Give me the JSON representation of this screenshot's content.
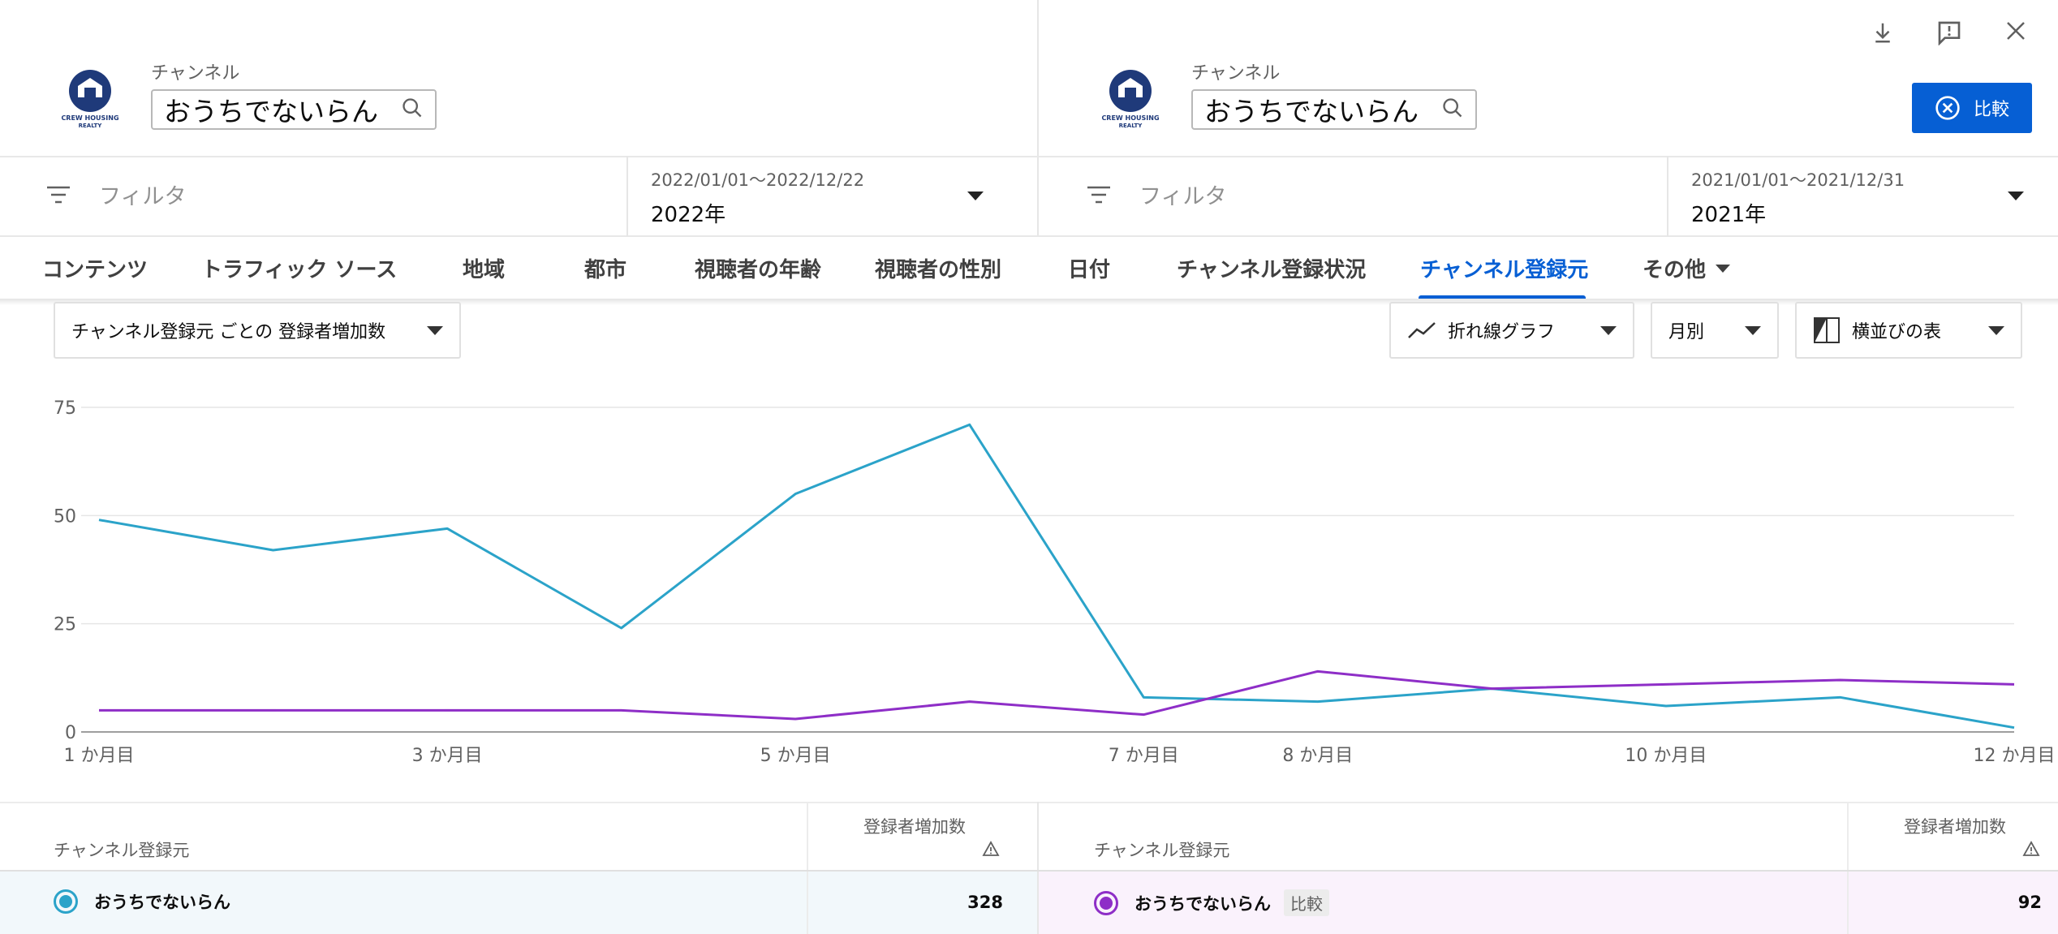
{
  "left_panel": {
    "logo_text": "CREW HOUSING REALTY",
    "channel_label": "チャンネル",
    "channel_name": "おうちでないらん",
    "filter_placeholder": "フィルタ",
    "date_range": "2022/01/01～2022/12/22",
    "date_label": "2022年"
  },
  "right_panel": {
    "logo_text": "CREW HOUSING REALTY",
    "channel_label": "チャンネル",
    "channel_name": "おうちでないらん",
    "filter_placeholder": "フィルタ",
    "date_range": "2021/01/01～2021/12/31",
    "date_label": "2021年",
    "compare_button": "比較"
  },
  "top_icons": [
    "download-icon",
    "feedback-icon",
    "close-icon"
  ],
  "tabs": [
    {
      "label": "コンテンツ"
    },
    {
      "label": "トラフィック ソース"
    },
    {
      "label": "地域"
    },
    {
      "label": "都市"
    },
    {
      "label": "視聴者の年齢"
    },
    {
      "label": "視聴者の性別"
    },
    {
      "label": "日付"
    },
    {
      "label": "チャンネル登録状況"
    },
    {
      "label": "チャンネル登録元",
      "active": true
    },
    {
      "label": "その他"
    }
  ],
  "controls": {
    "metric_select": "チャンネル登録元 ごとの 登録者増加数",
    "chart_type": "折れ線グラフ",
    "interval": "月別",
    "table_view": "横並びの表"
  },
  "chart_data": {
    "type": "line",
    "x": [
      1,
      2,
      3,
      4,
      5,
      6,
      7,
      8,
      9,
      10,
      11,
      12
    ],
    "x_tick_labels": [
      {
        "x": 1,
        "label": "1 か月目"
      },
      {
        "x": 3,
        "label": "3 か月目"
      },
      {
        "x": 5,
        "label": "5 か月目"
      },
      {
        "x": 7,
        "label": "7 か月目"
      },
      {
        "x": 8,
        "label": "8 か月目"
      },
      {
        "x": 10,
        "label": "10 か月目"
      },
      {
        "x": 12,
        "label": "12 か月目"
      }
    ],
    "y_ticks": [
      0,
      25,
      50,
      75
    ],
    "ylim": [
      0,
      75
    ],
    "grid": true,
    "series": [
      {
        "color": "#2ba3c9",
        "values": [
          49,
          42,
          47,
          24,
          55,
          71,
          8,
          7,
          10,
          6,
          8,
          1
        ]
      },
      {
        "color": "#8e2ec7",
        "values": [
          5,
          5,
          5,
          5,
          3,
          7,
          4,
          14,
          10,
          11,
          12,
          11
        ]
      }
    ]
  },
  "table": {
    "left": {
      "header_source": "チャンネル登録元",
      "header_metric": "登録者増加数",
      "row": {
        "name": "おうちでないらん",
        "value": "328",
        "color": "#2ba3c9"
      }
    },
    "right": {
      "header_source": "チャンネル登録元",
      "header_metric": "登録者増加数",
      "row": {
        "name": "おうちでないらん",
        "badge": "比較",
        "value": "92",
        "color": "#8e2ec7"
      }
    }
  }
}
